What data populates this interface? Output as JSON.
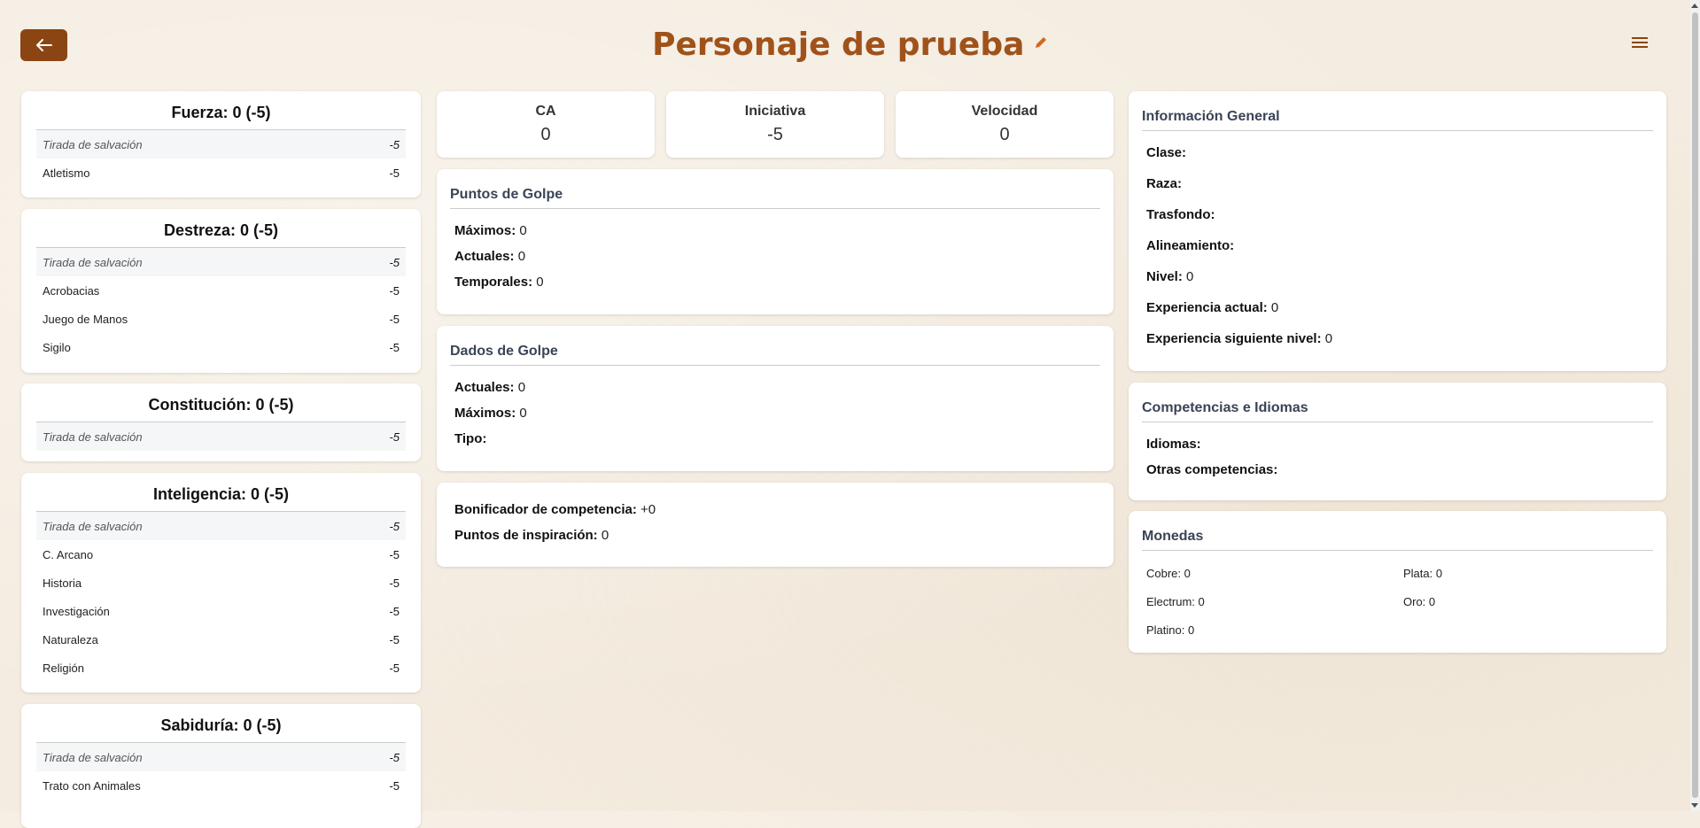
{
  "header": {
    "title": "Personaje de prueba"
  },
  "abilities": [
    {
      "title": "Fuerza: 0 (-5)",
      "rows": [
        {
          "label": "Tirada de salvación",
          "value": "-5",
          "save": true
        },
        {
          "label": "Atletismo",
          "value": "-5"
        }
      ]
    },
    {
      "title": "Destreza: 0 (-5)",
      "rows": [
        {
          "label": "Tirada de salvación",
          "value": "-5",
          "save": true
        },
        {
          "label": "Acrobacias",
          "value": "-5"
        },
        {
          "label": "Juego de Manos",
          "value": "-5"
        },
        {
          "label": "Sigilo",
          "value": "-5"
        }
      ]
    },
    {
      "title": "Constitución: 0 (-5)",
      "rows": [
        {
          "label": "Tirada de salvación",
          "value": "-5",
          "save": true
        }
      ]
    },
    {
      "title": "Inteligencia: 0 (-5)",
      "rows": [
        {
          "label": "Tirada de salvación",
          "value": "-5",
          "save": true
        },
        {
          "label": "C. Arcano",
          "value": "-5"
        },
        {
          "label": "Historia",
          "value": "-5"
        },
        {
          "label": "Investigación",
          "value": "-5"
        },
        {
          "label": "Naturaleza",
          "value": "-5"
        },
        {
          "label": "Religión",
          "value": "-5"
        }
      ]
    },
    {
      "title": "Sabiduría: 0 (-5)",
      "rows": [
        {
          "label": "Tirada de salvación",
          "value": "-5",
          "save": true
        },
        {
          "label": "Trato con Animales",
          "value": "-5"
        }
      ]
    }
  ],
  "stats": {
    "ca": {
      "label": "CA",
      "value": "0"
    },
    "iniciativa": {
      "label": "Iniciativa",
      "value": "-5"
    },
    "velocidad": {
      "label": "Velocidad",
      "value": "0"
    }
  },
  "hp": {
    "title": "Puntos de Golpe",
    "max_label": "Máximos:",
    "max": "0",
    "cur_label": "Actuales:",
    "cur": "0",
    "temp_label": "Temporales:",
    "temp": "0"
  },
  "hitdice": {
    "title": "Dados de Golpe",
    "cur_label": "Actuales:",
    "cur": "0",
    "max_label": "Máximos:",
    "max": "0",
    "type_label": "Tipo:",
    "type": ""
  },
  "misc": {
    "prof_label": "Bonificador de competencia:",
    "prof": "+0",
    "insp_label": "Puntos de inspiración:",
    "insp": "0"
  },
  "general": {
    "title": "Información General",
    "clase_label": "Clase:",
    "clase": "",
    "raza_label": "Raza:",
    "raza": "",
    "trasfondo_label": "Trasfondo:",
    "trasfondo": "",
    "alineamiento_label": "Alineamiento:",
    "alineamiento": "",
    "nivel_label": "Nivel:",
    "nivel": "0",
    "exp_label": "Experiencia actual:",
    "exp": "0",
    "exp_next_label": "Experiencia siguiente nivel:",
    "exp_next": "0"
  },
  "competencias": {
    "title": "Competencias e Idiomas",
    "idiomas_label": "Idiomas:",
    "idiomas": "",
    "otras_label": "Otras competencias:",
    "otras": ""
  },
  "monedas": {
    "title": "Monedas",
    "cobre": "Cobre: 0",
    "plata": "Plata: 0",
    "electrum": "Electrum: 0",
    "oro": "Oro: 0",
    "platino": "Platino: 0"
  }
}
